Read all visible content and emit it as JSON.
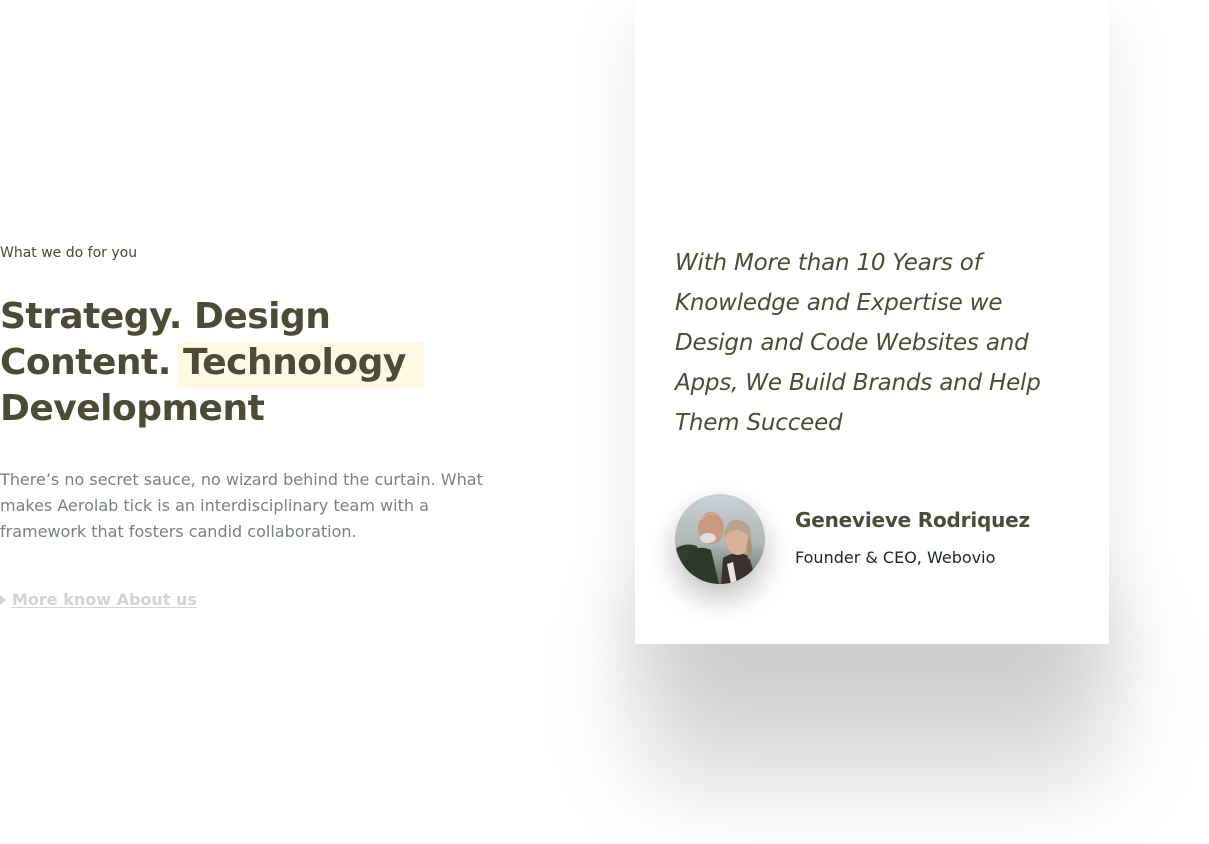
{
  "section": {
    "eyebrow": "What we do for you",
    "headline": {
      "line1": "Strategy. Design",
      "line2_prefix": "Content.",
      "line2_highlight": "Technology",
      "line3": "Development"
    },
    "description": "There’s no secret sauce, no wizard behind the curtain. What makes Aerolab tick is an interdisciplinary team with a framework that fosters candid collaboration.",
    "link_label": "More know About us"
  },
  "testimonial": {
    "quote": "With More than 10 Years of Knowledge and Expertise we Design and Code Websites and Apps, We Build Brands and Help Them Succeed",
    "author_name": "Genevieve Rodriquez",
    "author_role": "Founder & CEO, Webovio",
    "avatar": "couple-photo-avatar"
  },
  "colors": {
    "heading": "#4c4c36",
    "highlight": "#fdf9e3",
    "body_text": "#7a7f88",
    "link": "#d2d3d6",
    "role_text": "#1d2330"
  }
}
